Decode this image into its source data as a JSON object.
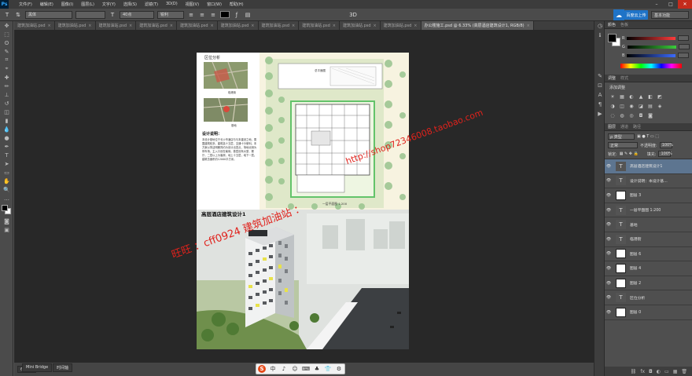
{
  "menu": {
    "logo": "Ps",
    "items": [
      "文件(F)",
      "编辑(E)",
      "图像(I)",
      "图层(L)",
      "文字(Y)",
      "选择(S)",
      "滤镜(T)",
      "3D(D)",
      "视图(V)",
      "窗口(W)",
      "帮助(H)"
    ],
    "window_controls": [
      "–",
      "□",
      "✕"
    ]
  },
  "options": {
    "tool_icon": "T",
    "font_family": "黑体",
    "font_size": "40点",
    "antialias": "锐利",
    "align": [
      "≡",
      "≡",
      "≡"
    ],
    "cloud_label": "百度云上传",
    "workspace": "基本功能"
  },
  "tabs": [
    {
      "label": "建筑加油站.psd",
      "active": false
    },
    {
      "label": "建筑加油站.psd",
      "active": false
    },
    {
      "label": "建筑加油站.psd",
      "active": false
    },
    {
      "label": "建筑加油站.psd",
      "active": false
    },
    {
      "label": "建筑加油站.psd",
      "active": false
    },
    {
      "label": "建筑加油站.psd",
      "active": false
    },
    {
      "label": "建筑加油站.psd",
      "active": false
    },
    {
      "label": "建筑加油站.psd",
      "active": false
    },
    {
      "label": "建筑加油站.psd",
      "active": false
    },
    {
      "label": "建筑加油站.psd",
      "active": false
    },
    {
      "label": "办公楼施工.psd @ 6.33% (高层酒店建筑设计1, RGB/8)",
      "active": true
    }
  ],
  "document": {
    "location_label": "区位分析",
    "caption_a": "临港街",
    "caption_b": "基地",
    "design_title": "设计说明：",
    "design_text": "本设计基地位于长沙市酒店与与本建设之地，周围建筑较多。建筑高十五层，交通十分便利。本方案以简洁明朗简约为设计出发点，场地北侧为停车场，主入口设在南侧。首层设有大堂、餐厅，二层以上为客房。地上十五层，地下一层。建筑总面积约12000平方米。",
    "plan_caption": "一层平面图 1:200",
    "plan_label": "总平面图",
    "project_title": "高层酒店建筑设计1"
  },
  "watermark": {
    "line1": "旺旺 ：cff0924 建筑加油站 ：",
    "line2": "http://shop72346008.taobao.com"
  },
  "status": {
    "zoom": "6.33%",
    "mini_bridge": "Mini Bridge",
    "timeline": "时间轴"
  },
  "ime": {
    "items": [
      "S",
      "中",
      "♪",
      "☺",
      "⌨",
      "♣",
      "👕",
      "⚙"
    ]
  },
  "color_panel": {
    "tabs": [
      "颜色",
      "色板"
    ],
    "channels": [
      {
        "label": "R",
        "color": "#ff3b3b",
        "value": ""
      },
      {
        "label": "G",
        "color": "#3bcc3b",
        "value": ""
      },
      {
        "label": "B",
        "color": "#3b6bff",
        "value": ""
      }
    ]
  },
  "adjust_panel": {
    "tabs": [
      "调整",
      "样式"
    ],
    "label": "添加调整",
    "row1": [
      "☀",
      "▦",
      "◐",
      "▲",
      "◧",
      "◩"
    ],
    "row2": [
      "◑",
      "◫",
      "◉",
      "◪",
      "▤",
      "◈"
    ],
    "row3": [
      "◌",
      "◍",
      "◎",
      "◘",
      "◙"
    ]
  },
  "layers_panel": {
    "tabs": [
      "图层",
      "通道",
      "路径"
    ],
    "kind": "ρ 类型",
    "blend": "正常",
    "opacity_label": "不透明度:",
    "opacity": "100%",
    "lock_label": "锁定:",
    "fill_label": "填充:",
    "fill": "100%",
    "layers": [
      {
        "name": "高层酒店建筑设计1",
        "thumb": "T",
        "text": true,
        "selected": true
      },
      {
        "name": "设计说明：本设计基...",
        "thumb": "T",
        "text": true,
        "selected": false
      },
      {
        "name": "图层 3",
        "thumb": "",
        "text": false,
        "selected": false
      },
      {
        "name": "一层平面图 1:200",
        "thumb": "T",
        "text": true,
        "selected": false
      },
      {
        "name": "基地",
        "thumb": "T",
        "text": true,
        "selected": false
      },
      {
        "name": "临港街",
        "thumb": "T",
        "text": true,
        "selected": false
      },
      {
        "name": "图层 6",
        "thumb": "",
        "text": false,
        "selected": false
      },
      {
        "name": "图层 4",
        "thumb": "",
        "text": false,
        "selected": false
      },
      {
        "name": "图层 2",
        "thumb": "",
        "text": false,
        "selected": false
      },
      {
        "name": "区位分析",
        "thumb": "T",
        "text": true,
        "selected": false
      },
      {
        "name": "图层 0",
        "thumb": "",
        "text": false,
        "selected": false
      }
    ],
    "footer_icons": [
      "⛓",
      "fx",
      "◘",
      "◐",
      "▭",
      "▦",
      "🗑"
    ]
  },
  "colors": {
    "accent": "#1f73c7",
    "selected_layer": "#5d7590",
    "watermark": "#e0221c",
    "canvas": "#282828"
  }
}
